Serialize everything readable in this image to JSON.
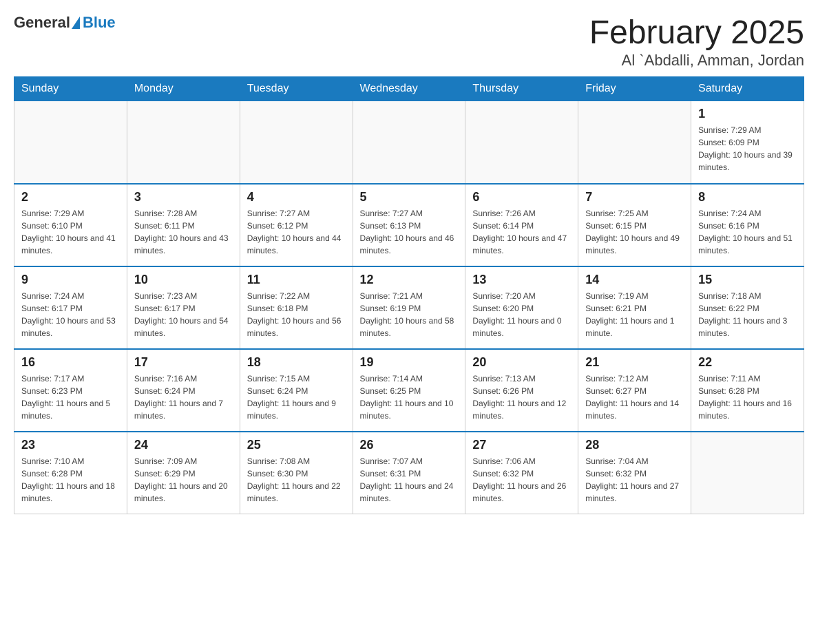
{
  "header": {
    "logo_general": "General",
    "logo_blue": "Blue",
    "month_title": "February 2025",
    "location": "Al `Abdalli, Amman, Jordan"
  },
  "weekdays": [
    "Sunday",
    "Monday",
    "Tuesday",
    "Wednesday",
    "Thursday",
    "Friday",
    "Saturday"
  ],
  "weeks": [
    [
      {
        "day": "",
        "info": ""
      },
      {
        "day": "",
        "info": ""
      },
      {
        "day": "",
        "info": ""
      },
      {
        "day": "",
        "info": ""
      },
      {
        "day": "",
        "info": ""
      },
      {
        "day": "",
        "info": ""
      },
      {
        "day": "1",
        "info": "Sunrise: 7:29 AM\nSunset: 6:09 PM\nDaylight: 10 hours and 39 minutes."
      }
    ],
    [
      {
        "day": "2",
        "info": "Sunrise: 7:29 AM\nSunset: 6:10 PM\nDaylight: 10 hours and 41 minutes."
      },
      {
        "day": "3",
        "info": "Sunrise: 7:28 AM\nSunset: 6:11 PM\nDaylight: 10 hours and 43 minutes."
      },
      {
        "day": "4",
        "info": "Sunrise: 7:27 AM\nSunset: 6:12 PM\nDaylight: 10 hours and 44 minutes."
      },
      {
        "day": "5",
        "info": "Sunrise: 7:27 AM\nSunset: 6:13 PM\nDaylight: 10 hours and 46 minutes."
      },
      {
        "day": "6",
        "info": "Sunrise: 7:26 AM\nSunset: 6:14 PM\nDaylight: 10 hours and 47 minutes."
      },
      {
        "day": "7",
        "info": "Sunrise: 7:25 AM\nSunset: 6:15 PM\nDaylight: 10 hours and 49 minutes."
      },
      {
        "day": "8",
        "info": "Sunrise: 7:24 AM\nSunset: 6:16 PM\nDaylight: 10 hours and 51 minutes."
      }
    ],
    [
      {
        "day": "9",
        "info": "Sunrise: 7:24 AM\nSunset: 6:17 PM\nDaylight: 10 hours and 53 minutes."
      },
      {
        "day": "10",
        "info": "Sunrise: 7:23 AM\nSunset: 6:17 PM\nDaylight: 10 hours and 54 minutes."
      },
      {
        "day": "11",
        "info": "Sunrise: 7:22 AM\nSunset: 6:18 PM\nDaylight: 10 hours and 56 minutes."
      },
      {
        "day": "12",
        "info": "Sunrise: 7:21 AM\nSunset: 6:19 PM\nDaylight: 10 hours and 58 minutes."
      },
      {
        "day": "13",
        "info": "Sunrise: 7:20 AM\nSunset: 6:20 PM\nDaylight: 11 hours and 0 minutes."
      },
      {
        "day": "14",
        "info": "Sunrise: 7:19 AM\nSunset: 6:21 PM\nDaylight: 11 hours and 1 minute."
      },
      {
        "day": "15",
        "info": "Sunrise: 7:18 AM\nSunset: 6:22 PM\nDaylight: 11 hours and 3 minutes."
      }
    ],
    [
      {
        "day": "16",
        "info": "Sunrise: 7:17 AM\nSunset: 6:23 PM\nDaylight: 11 hours and 5 minutes."
      },
      {
        "day": "17",
        "info": "Sunrise: 7:16 AM\nSunset: 6:24 PM\nDaylight: 11 hours and 7 minutes."
      },
      {
        "day": "18",
        "info": "Sunrise: 7:15 AM\nSunset: 6:24 PM\nDaylight: 11 hours and 9 minutes."
      },
      {
        "day": "19",
        "info": "Sunrise: 7:14 AM\nSunset: 6:25 PM\nDaylight: 11 hours and 10 minutes."
      },
      {
        "day": "20",
        "info": "Sunrise: 7:13 AM\nSunset: 6:26 PM\nDaylight: 11 hours and 12 minutes."
      },
      {
        "day": "21",
        "info": "Sunrise: 7:12 AM\nSunset: 6:27 PM\nDaylight: 11 hours and 14 minutes."
      },
      {
        "day": "22",
        "info": "Sunrise: 7:11 AM\nSunset: 6:28 PM\nDaylight: 11 hours and 16 minutes."
      }
    ],
    [
      {
        "day": "23",
        "info": "Sunrise: 7:10 AM\nSunset: 6:28 PM\nDaylight: 11 hours and 18 minutes."
      },
      {
        "day": "24",
        "info": "Sunrise: 7:09 AM\nSunset: 6:29 PM\nDaylight: 11 hours and 20 minutes."
      },
      {
        "day": "25",
        "info": "Sunrise: 7:08 AM\nSunset: 6:30 PM\nDaylight: 11 hours and 22 minutes."
      },
      {
        "day": "26",
        "info": "Sunrise: 7:07 AM\nSunset: 6:31 PM\nDaylight: 11 hours and 24 minutes."
      },
      {
        "day": "27",
        "info": "Sunrise: 7:06 AM\nSunset: 6:32 PM\nDaylight: 11 hours and 26 minutes."
      },
      {
        "day": "28",
        "info": "Sunrise: 7:04 AM\nSunset: 6:32 PM\nDaylight: 11 hours and 27 minutes."
      },
      {
        "day": "",
        "info": ""
      }
    ]
  ]
}
